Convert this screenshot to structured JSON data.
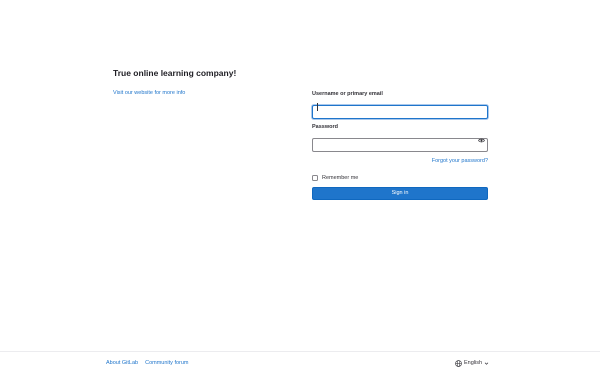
{
  "brand": {
    "title": "True online learning company!",
    "link_text": "Visit our website for more info"
  },
  "login": {
    "username_label": "Username or primary email",
    "username_value": "",
    "password_label": "Password",
    "password_value": "",
    "forgot_password": "Forgot your password?",
    "remember_me": "Remember me",
    "remember_checked": false,
    "signin_label": "Sign in"
  },
  "footer": {
    "about": "About GitLab",
    "community": "Community forum",
    "language": "English"
  },
  "icons": {
    "password_toggle": "eye-icon",
    "language": "globe-icon",
    "language_menu": "chevron-down-icon"
  },
  "colors": {
    "accent": "#1f75cb",
    "text": "#333238"
  }
}
